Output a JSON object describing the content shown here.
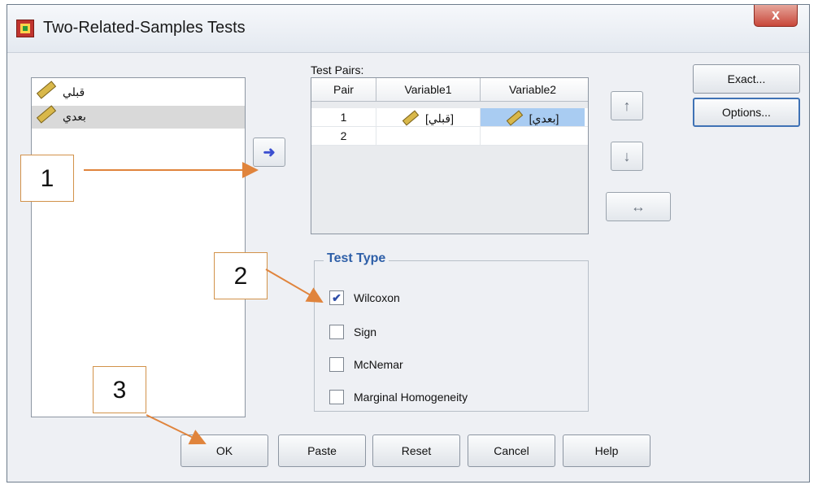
{
  "window": {
    "title": "Two-Related-Samples Tests",
    "close_label": "x"
  },
  "source_list": [
    {
      "label": "قبلي",
      "selected": false
    },
    {
      "label": "بعدي",
      "selected": true
    }
  ],
  "buttons": {
    "move": "➜",
    "up": "↑",
    "down": "↓",
    "swap": "↔",
    "exact": "Exact...",
    "options": "Options...",
    "ok": "OK",
    "paste": "Paste",
    "reset": "Reset",
    "cancel": "Cancel",
    "help": "Help"
  },
  "test_pairs": {
    "label": "Test Pairs:",
    "columns": [
      "Pair",
      "Variable1",
      "Variable2"
    ],
    "rows": [
      {
        "pair": "1",
        "variable1": "[قبلي]",
        "variable2": "[بعدي]"
      },
      {
        "pair": "2",
        "variable1": "",
        "variable2": ""
      }
    ]
  },
  "test_type": {
    "legend": "Test Type",
    "options": [
      {
        "label": "Wilcoxon",
        "checked": true
      },
      {
        "label": "Sign",
        "checked": false
      },
      {
        "label": "McNemar",
        "checked": false
      },
      {
        "label": "Marginal Homogeneity",
        "checked": false
      }
    ]
  },
  "callouts": [
    "1",
    "2",
    "3"
  ],
  "colors": {
    "annotation": "#e0843c",
    "selection": "#a9ccf2",
    "legend": "#2e5fa8"
  }
}
